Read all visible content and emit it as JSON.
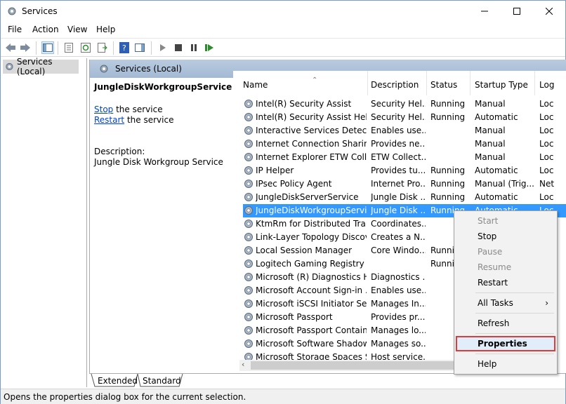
{
  "window": {
    "title": "Services"
  },
  "menu": [
    "File",
    "Action",
    "View",
    "Help"
  ],
  "tree": {
    "root_label": "Services (Local)"
  },
  "pane": {
    "header_title": "Services (Local)",
    "selected_service": "JungleDiskWorkgroupService",
    "stop_link": "Stop",
    "stop_suffix": " the service",
    "restart_link": "Restart",
    "restart_suffix": " the service",
    "description_label": "Description:",
    "description_text": "Jungle Disk Workgroup Service"
  },
  "columns": [
    "Name",
    "Description",
    "Status",
    "Startup Type",
    "Log"
  ],
  "rows": [
    {
      "name": "Intel(R) Security Assist",
      "desc": "Security Hel...",
      "status": "Running",
      "startup": "Manual",
      "log": "Loc"
    },
    {
      "name": "Intel(R) Security Assist Helper",
      "desc": "Security Hel...",
      "status": "Running",
      "startup": "Automatic",
      "log": "Loc"
    },
    {
      "name": "Interactive Services Detection",
      "desc": "Enables use...",
      "status": "",
      "startup": "Manual",
      "log": "Loc"
    },
    {
      "name": "Internet Connection Sharin...",
      "desc": "Provides ne...",
      "status": "",
      "startup": "Manual",
      "log": "Loc"
    },
    {
      "name": "Internet Explorer ETW Colle...",
      "desc": "ETW Collect...",
      "status": "",
      "startup": "Manual",
      "log": "Loc"
    },
    {
      "name": "IP Helper",
      "desc": "Provides tu...",
      "status": "Running",
      "startup": "Automatic",
      "log": "Loc"
    },
    {
      "name": "IPsec Policy Agent",
      "desc": "Internet Pro...",
      "status": "Running",
      "startup": "Manual (Trig...",
      "log": "Net"
    },
    {
      "name": "JungleDiskServerService",
      "desc": "Jungle Disk ...",
      "status": "Running",
      "startup": "Automatic",
      "log": "Loc"
    },
    {
      "name": "JungleDiskWorkgroupService",
      "desc": "Jungle Disk ...",
      "status": "Running",
      "startup": "Automatic",
      "log": "Loc",
      "selected": true
    },
    {
      "name": "KtmRm for Distributed Tran...",
      "desc": "Coordinates...",
      "status": "",
      "startup": "",
      "log": ""
    },
    {
      "name": "Link-Layer Topology Discov...",
      "desc": "Creates a N...",
      "status": "",
      "startup": "",
      "log": ""
    },
    {
      "name": "Local Session Manager",
      "desc": "Core Windo...",
      "status": "Runnin",
      "startup": "",
      "log": ""
    },
    {
      "name": "Logitech Gaming Registry S...",
      "desc": "",
      "status": "Runnin",
      "startup": "",
      "log": ""
    },
    {
      "name": "Microsoft (R) Diagnostics H...",
      "desc": "Diagnostics ...",
      "status": "",
      "startup": "",
      "log": ""
    },
    {
      "name": "Microsoft Account Sign-in ...",
      "desc": "Enables use...",
      "status": "",
      "startup": "",
      "log": ""
    },
    {
      "name": "Microsoft iSCSI Initiator Ser...",
      "desc": "Manages In...",
      "status": "",
      "startup": "",
      "log": ""
    },
    {
      "name": "Microsoft Passport",
      "desc": "Provides pr...",
      "status": "",
      "startup": "",
      "log": ""
    },
    {
      "name": "Microsoft Passport Container",
      "desc": "Manages lo...",
      "status": "",
      "startup": "",
      "log": ""
    },
    {
      "name": "Microsoft Software Shadow...",
      "desc": "Manages so...",
      "status": "",
      "startup": "",
      "log": ""
    },
    {
      "name": "Microsoft Storage Spaces S...",
      "desc": "Host service...",
      "status": "",
      "startup": "",
      "log": ""
    }
  ],
  "context_menu": {
    "start": "Start",
    "stop": "Stop",
    "pause": "Pause",
    "resume": "Resume",
    "restart": "Restart",
    "all_tasks": "All Tasks",
    "refresh": "Refresh",
    "properties": "Properties",
    "help": "Help"
  },
  "tabs": [
    "Extended",
    "Standard"
  ],
  "status_bar": "Opens the properties dialog box for the current selection.",
  "colors": {
    "selection": "#3399ff",
    "header": "#b9cbe0",
    "highlight_border": "#e03b3b"
  }
}
